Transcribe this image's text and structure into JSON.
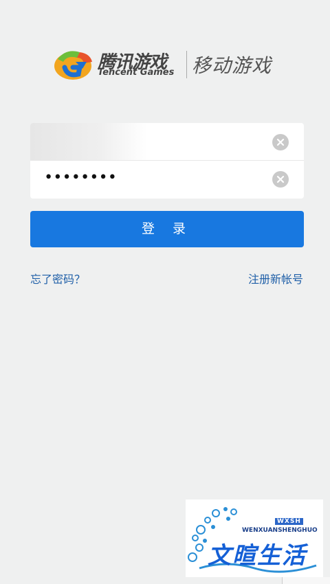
{
  "logo": {
    "cn_name": "腾讯游戏",
    "en_name": "Tencent Games",
    "subtitle": "移动游戏",
    "icon": "tencent-games-logo-icon"
  },
  "form": {
    "username_value": "",
    "password_value": "••••••••",
    "clear_icon": "clear-circle-icon"
  },
  "login_button": {
    "label": "登 录"
  },
  "links": {
    "forgot": "忘了密码？",
    "register": "注册新帐号"
  },
  "watermark": {
    "cn": "文暄生活",
    "en": "WENXUANSHENGHUO",
    "badge": "WXSH"
  },
  "colors": {
    "background": "#eff0f0",
    "primary_button": "#1878e0",
    "link": "#1f5fa8"
  }
}
